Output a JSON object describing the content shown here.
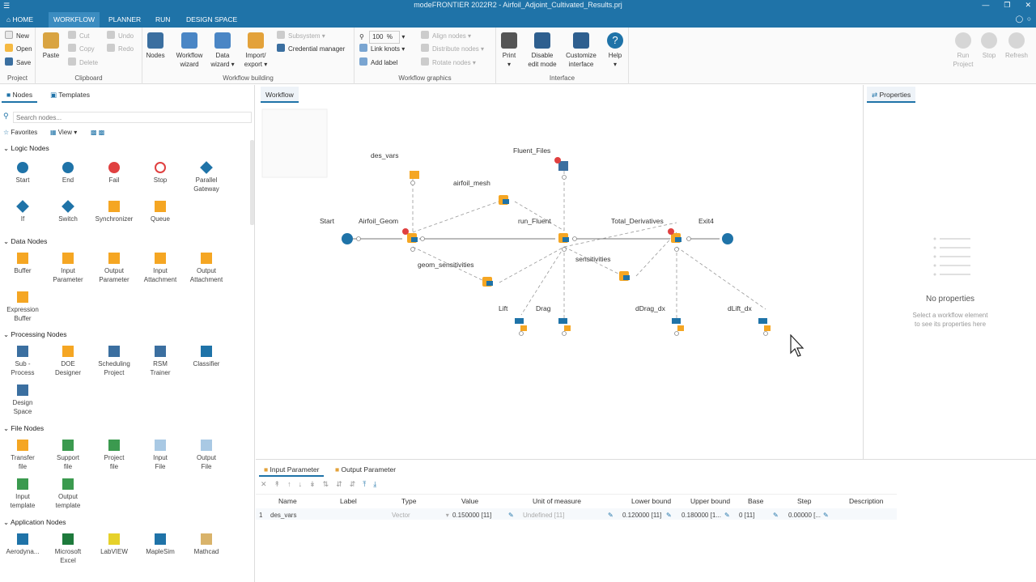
{
  "window": {
    "title": "modeFRONTIER 2022R2 - Airfoil_Adjoint_Cultivated_Results.prj"
  },
  "menu": {
    "items": [
      {
        "id": "home",
        "label": "HOME"
      },
      {
        "id": "workflow",
        "label": "WORKFLOW"
      },
      {
        "id": "planner",
        "label": "PLANNER"
      },
      {
        "id": "run",
        "label": "RUN"
      },
      {
        "id": "design_space",
        "label": "DESIGN SPACE"
      }
    ],
    "help_icon": "help-circle-icon"
  },
  "ribbon": {
    "project": {
      "new": "New",
      "open": "Open",
      "save": "Save",
      "group": "Project"
    },
    "clipboard": {
      "paste": "Paste",
      "cut": "Cut",
      "copy": "Copy",
      "delete": "Delete",
      "undo": "Undo",
      "redo": "Redo",
      "group": "Clipboard"
    },
    "building": {
      "nodes": "Nodes",
      "workflow_wizard_1": "Workflow",
      "workflow_wizard_2": "wizard",
      "data_wizard_1": "Data",
      "data_wizard_2": "wizard",
      "import_1": "Import/",
      "import_2": "export",
      "subsystem": "Subsystem",
      "credential": "Credential manager",
      "group": "Workflow building"
    },
    "graphics": {
      "zoom_value": "100",
      "zoom_unit": "%",
      "link_knots": "Link knots",
      "add_label": "Add label",
      "align_nodes": "Align nodes",
      "distribute_nodes": "Distribute nodes",
      "rotate_nodes": "Rotate nodes",
      "group": "Workflow graphics"
    },
    "interface": {
      "print": "Print",
      "disable_1": "Disable",
      "disable_2": "edit mode",
      "customize_1": "Customize",
      "customize_2": "interface",
      "help": "Help",
      "group": "Interface"
    },
    "run": {
      "run_1": "Run",
      "run_2": "Project",
      "stop": "Stop",
      "refresh": "Refresh"
    }
  },
  "left_panel": {
    "tabs": [
      "Nodes",
      "Templates"
    ],
    "search_placeholder": "Search nodes...",
    "favorites": "Favorites",
    "view": "View",
    "sections": {
      "logic": "Logic Nodes",
      "data": "Data Nodes",
      "processing": "Processing Nodes",
      "file": "File Nodes",
      "application": "Application Nodes"
    },
    "logic_nodes": [
      {
        "l1": "Start",
        "l2": ""
      },
      {
        "l1": "End",
        "l2": ""
      },
      {
        "l1": "Fail",
        "l2": ""
      },
      {
        "l1": "Stop",
        "l2": ""
      },
      {
        "l1": "Parallel",
        "l2": "Gateway"
      },
      {
        "l1": "If",
        "l2": ""
      },
      {
        "l1": "Switch",
        "l2": ""
      },
      {
        "l1": "Synchronizer",
        "l2": ""
      },
      {
        "l1": "Queue",
        "l2": ""
      }
    ],
    "data_nodes": [
      {
        "l1": "Buffer",
        "l2": ""
      },
      {
        "l1": "Input",
        "l2": "Parameter"
      },
      {
        "l1": "Output",
        "l2": "Parameter"
      },
      {
        "l1": "Input",
        "l2": "Attachment"
      },
      {
        "l1": "Output",
        "l2": "Attachment"
      },
      {
        "l1": "Expression",
        "l2": "Buffer"
      }
    ],
    "processing_nodes": [
      {
        "l1": "Sub -",
        "l2": "Process"
      },
      {
        "l1": "DOE",
        "l2": "Designer"
      },
      {
        "l1": "Scheduling",
        "l2": "Project"
      },
      {
        "l1": "RSM",
        "l2": "Trainer"
      },
      {
        "l1": "Classifier",
        "l2": ""
      },
      {
        "l1": "Design",
        "l2": "Space"
      }
    ],
    "file_nodes": [
      {
        "l1": "Transfer",
        "l2": "file"
      },
      {
        "l1": "Support",
        "l2": "file"
      },
      {
        "l1": "Project",
        "l2": "file"
      },
      {
        "l1": "Input",
        "l2": "File"
      },
      {
        "l1": "Output",
        "l2": "File"
      },
      {
        "l1": "Input",
        "l2": "template"
      },
      {
        "l1": "Output",
        "l2": "template"
      }
    ],
    "application_nodes": [
      {
        "l1": "Aerodyna...",
        "l2": ""
      },
      {
        "l1": "Microsoft",
        "l2": "Excel"
      },
      {
        "l1": "LabVIEW",
        "l2": ""
      },
      {
        "l1": "MapleSim",
        "l2": ""
      },
      {
        "l1": "Mathcad",
        "l2": ""
      }
    ]
  },
  "workflow": {
    "tab": "Workflow",
    "nodes": {
      "des_vars": "des_vars",
      "fluent_files": "Fluent_Files",
      "airfoil_mesh": "airfoil_mesh",
      "start": "Start",
      "airfoil_geom": "Airfoil_Geom",
      "run_fluent": "run_Fluent",
      "total_derivatives": "Total_Derivatives",
      "exit": "Exit4",
      "geom_sensitivities": "geom_sensitivities",
      "sensitivities": "sensitivities",
      "lift": "Lift",
      "drag": "Drag",
      "ddrag_dx": "dDrag_dx",
      "dlift_dx": "dLift_dx"
    }
  },
  "properties": {
    "tab": "Properties",
    "empty_title": "No properties",
    "empty_sub_1": "Select a workflow element",
    "empty_sub_2": "to see its properties here"
  },
  "bottom": {
    "tabs": [
      "Input Parameter",
      "Output Parameter"
    ],
    "columns": [
      "Name",
      "Label",
      "Type",
      "Value",
      "Unit of measure",
      "Lower bound",
      "Upper bound",
      "Base",
      "Step",
      "Description"
    ],
    "rows": [
      {
        "index": "1",
        "name": "des_vars",
        "label": "",
        "type": "Vector",
        "value": "0.150000 [11]",
        "unit": "Undefined [11]",
        "lower": "0.120000 [11]",
        "upper": "0.180000 [1...",
        "base": "0 [11]",
        "step": "0.00000 [...",
        "description": ""
      }
    ]
  },
  "colors": {
    "accent": "#1f73a8",
    "node_orange": "#f5a623",
    "error_red": "#e04040"
  }
}
